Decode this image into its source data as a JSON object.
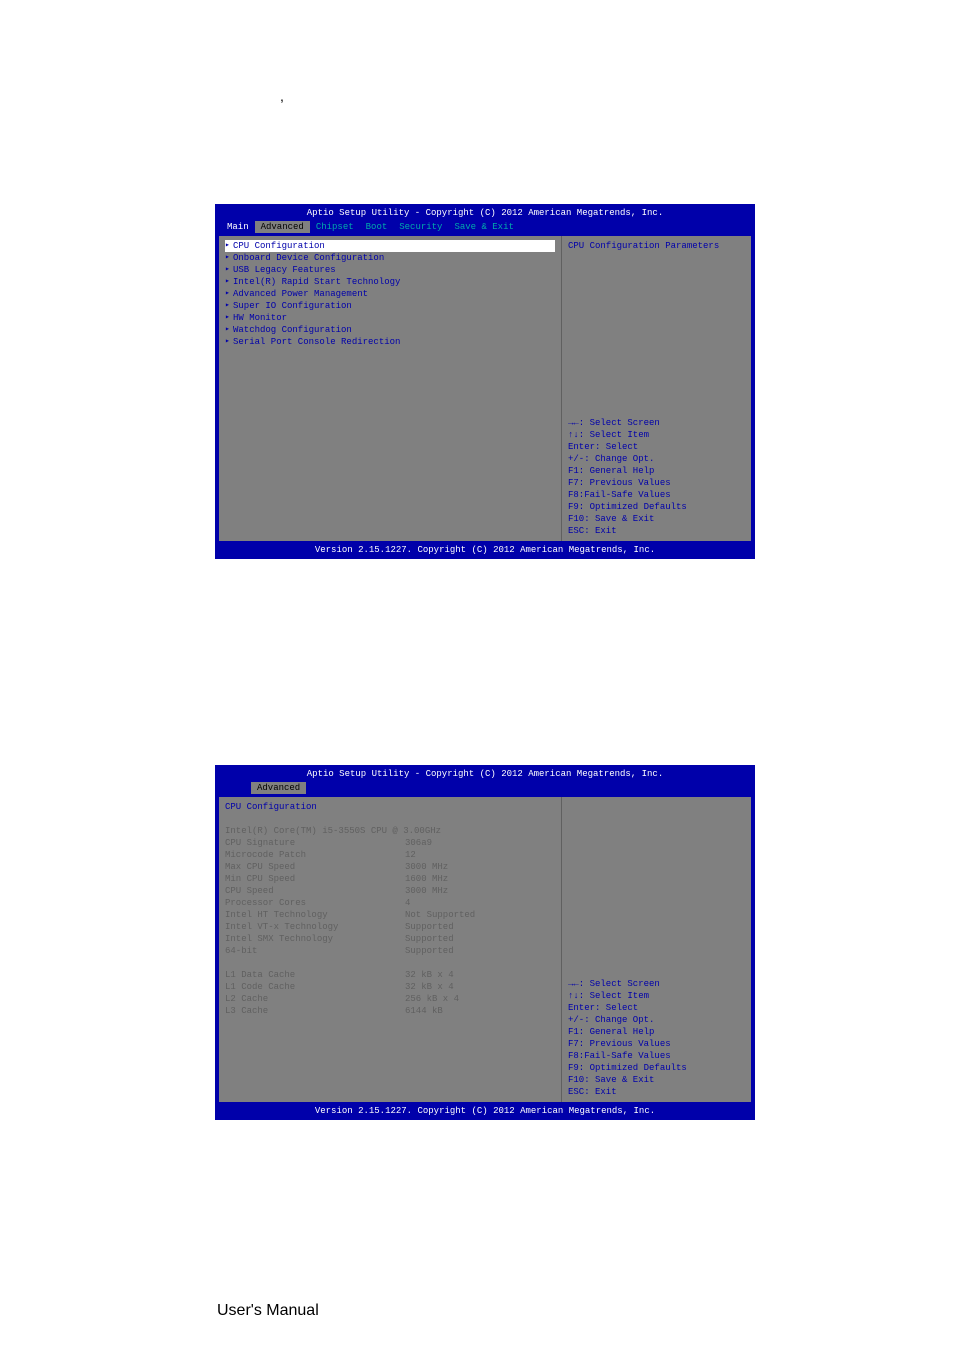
{
  "comma_char": ",",
  "bios1": {
    "header": "Aptio Setup Utility - Copyright (C) 2012 American Megatrends, Inc.",
    "menu": {
      "main": "Main",
      "advanced": "Advanced",
      "chipset": "Chipset",
      "boot": "Boot",
      "security": "Security",
      "save_exit": "Save & Exit"
    },
    "items": [
      "CPU Configuration",
      "Onboard Device Configuration",
      "USB Legacy Features",
      "Intel(R) Rapid Start Technology",
      "Advanced Power Management",
      "Super IO Configuration",
      "HW Monitor",
      "Watchdog Configuration",
      "Serial Port Console Redirection"
    ],
    "help_title": "CPU Configuration Parameters",
    "keys": [
      "→←: Select Screen",
      "↑↓: Select Item",
      "Enter: Select",
      "+/-: Change Opt.",
      "F1: General Help",
      "F7: Previous Values",
      "F8:Fail-Safe Values",
      "F9: Optimized Defaults",
      "F10: Save & Exit",
      "ESC: Exit"
    ],
    "footer": "Version 2.15.1227. Copyright (C) 2012 American Megatrends, Inc."
  },
  "bios2": {
    "header": "Aptio Setup Utility - Copyright (C) 2012 American Megatrends, Inc.",
    "menu": {
      "advanced": "Advanced"
    },
    "title": "CPU Configuration",
    "cpu_name": "Intel(R) Core(TM) i5-3550S CPU @ 3.00GHz",
    "rows": [
      {
        "label": "CPU Signature",
        "value": "306a9"
      },
      {
        "label": "Microcode Patch",
        "value": "12"
      },
      {
        "label": "Max CPU Speed",
        "value": "3000 MHz"
      },
      {
        "label": "Min CPU Speed",
        "value": "1600 MHz"
      },
      {
        "label": "CPU Speed",
        "value": "3000 MHz"
      },
      {
        "label": "Processor Cores",
        "value": "4"
      },
      {
        "label": "Intel HT Technology",
        "value": "Not Supported"
      },
      {
        "label": "Intel VT-x Technology",
        "value": "Supported"
      },
      {
        "label": "Intel SMX Technology",
        "value": "Supported"
      },
      {
        "label": "64-bit",
        "value": "Supported"
      }
    ],
    "cache_rows": [
      {
        "label": "L1 Data Cache",
        "value": "32 kB x 4"
      },
      {
        "label": "L1 Code Cache",
        "value": "32 kB x 4"
      },
      {
        "label": "L2 Cache",
        "value": "256 kB x 4"
      },
      {
        "label": "L3 Cache",
        "value": "6144 kB"
      }
    ],
    "keys": [
      "→←: Select Screen",
      "↑↓: Select Item",
      "Enter: Select",
      "+/-: Change Opt.",
      "F1: General Help",
      "F7: Previous Values",
      "F8:Fail-Safe Values",
      "F9: Optimized Defaults",
      "F10: Save & Exit",
      "ESC: Exit"
    ],
    "footer": "Version 2.15.1227. Copyright (C) 2012 American Megatrends, Inc."
  },
  "footer_text": "User's Manual"
}
